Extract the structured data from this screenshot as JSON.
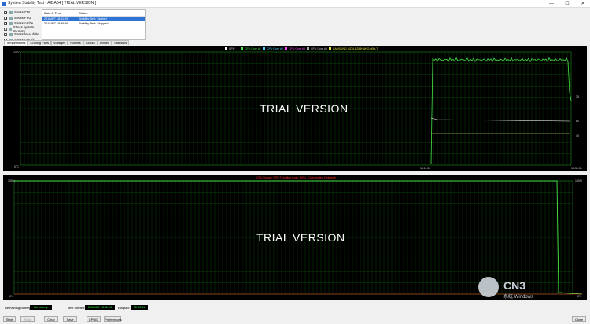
{
  "window": {
    "title": "System Stability Test - AIDA64  [ TRIAL VERSION ]",
    "minimize": "—",
    "maximize": "☐",
    "close": "✕"
  },
  "stress_items": [
    {
      "label": "Stress CPU",
      "checked": true
    },
    {
      "label": "Stress FPU",
      "checked": true
    },
    {
      "label": "Stress cache",
      "checked": true
    },
    {
      "label": "Stress system memory",
      "checked": false
    },
    {
      "label": "Stress local disks",
      "checked": false
    },
    {
      "label": "Stress GPU(s)",
      "checked": false
    }
  ],
  "status_table": {
    "headers": [
      "Date & Time",
      "Status"
    ],
    "rows": [
      {
        "time": "2018/8/7 18:11:25",
        "status": "Stability Test: Started",
        "selected": true
      },
      {
        "time": "2018/8/7 18:36:36",
        "status": "Stability Test: Stopped",
        "selected": false
      }
    ]
  },
  "tabs": [
    "Temperatures",
    "Cooling Fans",
    "Voltages",
    "Powers",
    "Clocks",
    "Unified",
    "Statistics"
  ],
  "temp_chart": {
    "legend": [
      "CPU",
      "CPU Core #1",
      "CPU Core #2",
      "CPU Core #3",
      "CPU Core #4",
      "SAMSUNG MZVLB256HAHQ-000L7"
    ],
    "y_top": "100°C",
    "y_bottom": "0°C",
    "right_labels": [
      "80",
      "40",
      "35"
    ],
    "x_left": "18:11:24",
    "x_right": "18:36:36",
    "trial": "TRIAL VERSION"
  },
  "cpu_chart": {
    "legend": "CPU Usage  |  CPU Throttling (max: 80%) - Overheating Detected!",
    "y_top": "100%",
    "y_bottom": "0%",
    "right_top": "100%",
    "right_bottom": "0%",
    "trial": "TRIAL VERSION"
  },
  "status_bar": {
    "battery_label": "Remaining Battery:",
    "battery_value": "No battery",
    "started_label": "Test Started:",
    "started_value": "2018/8/7 18:11:24",
    "elapsed_label": "Elapsed Time:",
    "elapsed_value": "00:25:11"
  },
  "buttons": {
    "start": "Start",
    "stop": "Stop",
    "clear": "Clear",
    "save": "Save",
    "cpuid": "CPUID",
    "preferences": "Preferences",
    "close": "Close"
  },
  "watermark": {
    "brand": "CN3",
    "sub": "系统 Windows"
  },
  "colors": {
    "chart_bg": "#000000",
    "grid": "#0d6b0d",
    "cpu_line": "#49e649",
    "accent_row": "#2f75d6",
    "red": "#ff2a2a"
  }
}
